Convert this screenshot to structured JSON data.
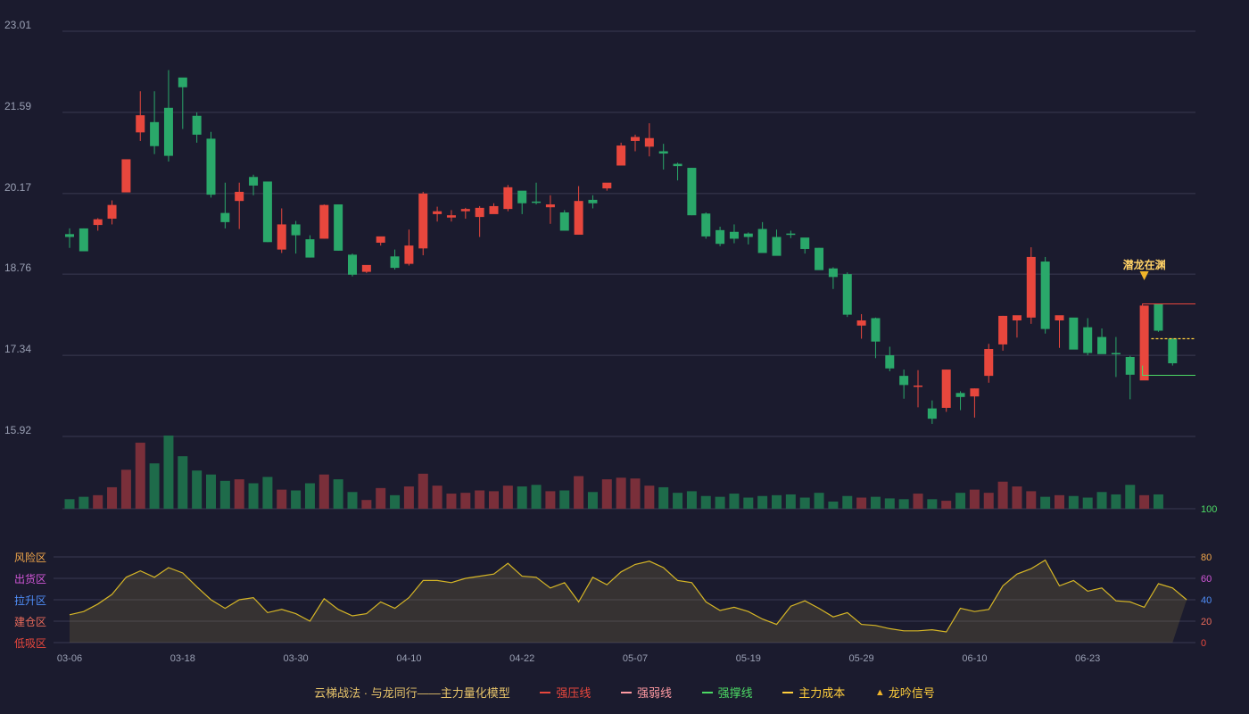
{
  "chart_data": {
    "type": "candlestick",
    "x_tick_labels": [
      "03-06",
      "03-18",
      "03-30",
      "04-10",
      "04-22",
      "05-07",
      "05-19",
      "05-29",
      "06-10",
      "06-23"
    ],
    "x_tick_index": [
      0,
      8,
      16,
      24,
      32,
      40,
      48,
      56,
      64,
      72
    ],
    "price_axis": {
      "ticks": [
        15.92,
        17.34,
        18.76,
        20.17,
        21.59,
        23.01
      ],
      "ylim": [
        15.92,
        23.01
      ]
    },
    "ohlc": [
      [
        19.46,
        19.41,
        19.56,
        19.22
      ],
      [
        19.56,
        19.16,
        19.56,
        19.16
      ],
      [
        19.62,
        19.72,
        19.74,
        19.52
      ],
      [
        19.73,
        19.97,
        20.05,
        19.63
      ],
      [
        20.19,
        20.77,
        20.75,
        20.31
      ],
      [
        21.24,
        21.54,
        21.96,
        21.09
      ],
      [
        21.42,
        21.0,
        21.96,
        20.86
      ],
      [
        21.67,
        20.83,
        22.33,
        20.73
      ],
      [
        22.2,
        22.03,
        22.18,
        21.3
      ],
      [
        21.53,
        21.2,
        21.59,
        21.06
      ],
      [
        21.13,
        20.15,
        21.25,
        20.1
      ],
      [
        19.83,
        19.67,
        20.36,
        19.56
      ],
      [
        20.04,
        20.2,
        20.36,
        19.55
      ],
      [
        20.46,
        20.31,
        20.5,
        20.14
      ],
      [
        20.38,
        19.32,
        20.37,
        19.32
      ],
      [
        19.19,
        19.63,
        19.91,
        19.13
      ],
      [
        19.63,
        19.44,
        19.69,
        19.12
      ],
      [
        19.37,
        19.05,
        19.44,
        19.05
      ],
      [
        19.38,
        19.97,
        19.98,
        19.38
      ],
      [
        19.98,
        19.17,
        19.98,
        19.17
      ],
      [
        19.1,
        18.75,
        19.12,
        18.72
      ],
      [
        18.8,
        18.92,
        18.89,
        18.78
      ],
      [
        19.31,
        19.42,
        19.36,
        19.26
      ],
      [
        19.07,
        18.87,
        19.19,
        18.84
      ],
      [
        18.94,
        19.26,
        19.54,
        18.91
      ],
      [
        19.21,
        20.17,
        20.2,
        19.09
      ],
      [
        19.81,
        19.86,
        19.94,
        19.68
      ],
      [
        19.75,
        19.79,
        19.88,
        19.68
      ],
      [
        19.86,
        19.9,
        19.92,
        19.73
      ],
      [
        19.76,
        19.92,
        19.95,
        19.41
      ],
      [
        19.81,
        19.95,
        20.0,
        19.83
      ],
      [
        19.9,
        20.28,
        20.32,
        19.86
      ],
      [
        20.22,
        20.0,
        20.2,
        19.81
      ],
      [
        20.03,
        20.01,
        20.36,
        19.98
      ],
      [
        19.93,
        19.98,
        20.14,
        19.64
      ],
      [
        19.84,
        19.52,
        19.88,
        19.52
      ],
      [
        19.45,
        20.04,
        20.3,
        19.45
      ],
      [
        20.06,
        20.0,
        20.14,
        19.91
      ],
      [
        20.26,
        20.36,
        20.31,
        20.22
      ],
      [
        20.66,
        21.01,
        21.06,
        20.67
      ],
      [
        21.09,
        21.16,
        21.2,
        20.91
      ],
      [
        20.99,
        21.14,
        21.4,
        20.82
      ],
      [
        20.91,
        20.87,
        21.04,
        20.59
      ],
      [
        20.69,
        20.65,
        20.71,
        20.4
      ],
      [
        20.62,
        19.79,
        20.62,
        19.79
      ],
      [
        19.82,
        19.42,
        19.84,
        19.38
      ],
      [
        19.53,
        19.29,
        19.59,
        19.25
      ],
      [
        19.5,
        19.38,
        19.63,
        19.3
      ],
      [
        19.47,
        19.41,
        19.49,
        19.28
      ],
      [
        19.55,
        19.13,
        19.67,
        19.14
      ],
      [
        19.41,
        19.08,
        19.54,
        19.13
      ],
      [
        19.47,
        19.46,
        19.52,
        19.39
      ],
      [
        19.4,
        19.2,
        19.39,
        19.12
      ],
      [
        19.22,
        18.83,
        19.22,
        18.85
      ],
      [
        18.86,
        18.71,
        18.88,
        18.5
      ],
      [
        18.76,
        18.05,
        18.79,
        18.01
      ],
      [
        17.86,
        17.95,
        18.06,
        17.63
      ],
      [
        17.99,
        17.58,
        18.0,
        17.29
      ],
      [
        17.34,
        17.11,
        17.49,
        17.06
      ],
      [
        16.98,
        16.82,
        17.09,
        16.58
      ],
      [
        16.79,
        16.81,
        17.08,
        16.43
      ],
      [
        16.41,
        16.23,
        16.55,
        16.14
      ],
      [
        16.42,
        17.09,
        17.09,
        16.35
      ],
      [
        16.68,
        16.61,
        16.71,
        16.38
      ],
      [
        16.62,
        16.76,
        16.76,
        16.25
      ],
      [
        16.98,
        17.45,
        17.54,
        16.86
      ],
      [
        17.53,
        18.03,
        18.03,
        17.42
      ],
      [
        17.95,
        18.04,
        18.03,
        17.65
      ],
      [
        18.0,
        19.06,
        19.23,
        17.89
      ],
      [
        18.98,
        17.8,
        19.06,
        17.72
      ],
      [
        17.95,
        18.04,
        17.99,
        17.47
      ],
      [
        18.0,
        17.44,
        17.93,
        17.47
      ],
      [
        17.83,
        17.38,
        17.99,
        17.34
      ],
      [
        17.66,
        17.36,
        17.81,
        17.42
      ],
      [
        17.38,
        17.36,
        17.66,
        16.96
      ],
      [
        17.31,
        17.0,
        17.33,
        16.57
      ],
      [
        16.9,
        18.21,
        18.13,
        16.92
      ],
      [
        18.24,
        17.77,
        18.22,
        17.75
      ],
      [
        17.63,
        17.2,
        17.64,
        17.16
      ]
    ],
    "volume_axis": {
      "top_label": "100"
    },
    "volume": [
      12,
      15,
      17,
      27,
      49,
      83,
      57,
      92,
      66,
      48,
      43,
      35,
      37,
      32,
      40,
      24,
      23,
      32,
      43,
      37,
      21,
      11,
      26,
      17,
      28,
      44,
      29,
      19,
      20,
      23,
      22,
      29,
      28,
      30,
      22,
      23,
      41,
      21,
      37,
      39,
      38,
      29,
      27,
      20,
      22,
      16,
      15,
      19,
      14,
      16,
      17,
      18,
      14,
      20,
      9,
      16,
      14,
      15,
      13,
      12,
      19,
      12,
      10,
      20,
      24,
      20,
      34,
      28,
      22,
      15,
      17,
      16,
      14,
      21,
      18,
      30,
      17,
      18
    ],
    "indicator_axis": {
      "ticks": [
        0,
        20,
        40,
        60,
        80
      ],
      "ylim": [
        0,
        100
      ]
    },
    "indicator_zones": [
      "风险区",
      "出货区",
      "拉升区",
      "建仓区",
      "低吸区"
    ],
    "indicator": [
      26,
      29,
      36,
      45,
      61,
      67,
      61,
      70,
      65,
      52,
      40,
      32,
      40,
      42,
      28,
      31,
      27,
      20,
      41,
      31,
      25,
      27,
      38,
      32,
      42,
      58,
      58,
      56,
      60,
      62,
      64,
      74,
      62,
      61,
      51,
      56,
      38,
      61,
      54,
      66,
      73,
      76,
      70,
      58,
      56,
      38,
      30,
      33,
      29,
      22,
      17,
      34,
      39,
      32,
      24,
      28,
      17,
      16,
      13,
      11,
      11,
      12,
      10,
      32,
      29,
      31,
      53,
      64,
      69,
      77,
      53,
      58,
      48,
      51,
      39,
      38,
      33,
      55,
      51,
      40
    ],
    "annotation": {
      "text": "潜龙在渊",
      "index": 76
    },
    "level_lines": {
      "strong_pressure": 18.24,
      "strong_support": 16.99,
      "main_cost": 17.63
    },
    "legend": {
      "title": "云梯战法 · 与龙同行——主力量化模型",
      "items": [
        {
          "label": "强压线",
          "color": "#e8473d"
        },
        {
          "label": "强弱线",
          "color": "#ff9aa2"
        },
        {
          "label": "强撑线",
          "color": "#4cd964"
        },
        {
          "label": "主力成本",
          "color": "#ffce3c"
        },
        {
          "label": "龙吟信号",
          "color": "#f0b429"
        }
      ]
    },
    "colors": {
      "up": "#e8473d",
      "down": "#2aa86a",
      "vol_up": "#7a2f3a",
      "vol_down": "#1e6b4a",
      "indicator": "#d6b626",
      "grid": "#3a3a52",
      "text": "#9aa0b4"
    }
  }
}
